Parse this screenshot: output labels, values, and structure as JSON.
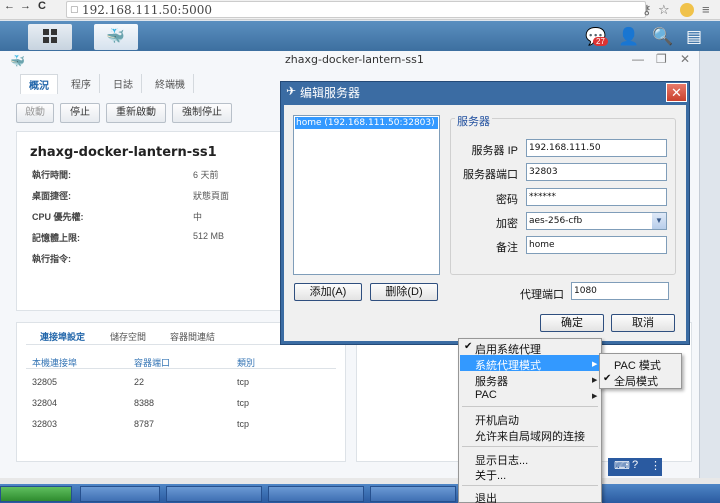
{
  "browser": {
    "url": "192.168.111.50:5000",
    "back": "←",
    "forward": "→",
    "reload": "C",
    "page_icon": "▢",
    "right_icons": [
      "key-icon",
      "star-icon",
      "extension-icon",
      "menu-icon"
    ]
  },
  "dsm": {
    "notification_count": "27"
  },
  "docker": {
    "window_title": "zhaxg-docker-lantern-ss1",
    "tabs": [
      "概況",
      "程序",
      "日誌",
      "終端機"
    ],
    "actions": [
      "啟動",
      "停止",
      "重新啟動",
      "強制停止"
    ],
    "container_name": "zhaxg-docker-lantern-ss1",
    "info": [
      {
        "label": "執行時間:",
        "value": "6 天前"
      },
      {
        "label": "桌面捷徑:",
        "value": "狀態頁面"
      },
      {
        "label": "CPU 優先權:",
        "value": "中"
      },
      {
        "label": "記憶體上限:",
        "value": "512 MB"
      },
      {
        "label": "執行指令:",
        "value": ""
      }
    ],
    "bottom_tabs": [
      "連接埠設定",
      "儲存空間",
      "容器間連結"
    ],
    "port_headers": [
      "本機連接埠",
      "容器端口",
      "類別"
    ],
    "ports": [
      [
        "32805",
        "22",
        "tcp"
      ],
      [
        "32804",
        "8388",
        "tcp"
      ],
      [
        "32803",
        "8787",
        "tcp"
      ]
    ]
  },
  "dialog": {
    "title": "编辑服务器",
    "server_list": [
      "home (192.168.111.50:32803)"
    ],
    "group_title": "服务器",
    "fields": {
      "ip_label": "服务器 IP",
      "ip_value": "192.168.111.50",
      "port_label": "服务器端口",
      "port_value": "32803",
      "password_label": "密码",
      "password_value": "******",
      "encrypt_label": "加密",
      "encrypt_value": "aes-256-cfb",
      "remark_label": "备注",
      "remark_value": "home",
      "proxy_port_label": "代理端口",
      "proxy_port_value": "1080"
    },
    "add_button": "添加(A)",
    "delete_button": "删除(D)",
    "ok_button": "确定",
    "cancel_button": "取消"
  },
  "context_menu": {
    "items": {
      "enable_proxy": "启用系统代理",
      "proxy_mode": "系統代理模式",
      "servers": "服务器",
      "pac": "PAC",
      "autostart": "开机启动",
      "allow_lan": "允许来自局域网的连接",
      "show_log": "显示日志...",
      "about": "关于...",
      "quit": "退出"
    },
    "submenu": {
      "pac_mode": "PAC 模式",
      "global_mode": "全局模式"
    }
  },
  "colors": {
    "accent": "#3399ff",
    "dsm_bar": "#3d6f9f",
    "dialog_frame": "#3b6ca3"
  }
}
